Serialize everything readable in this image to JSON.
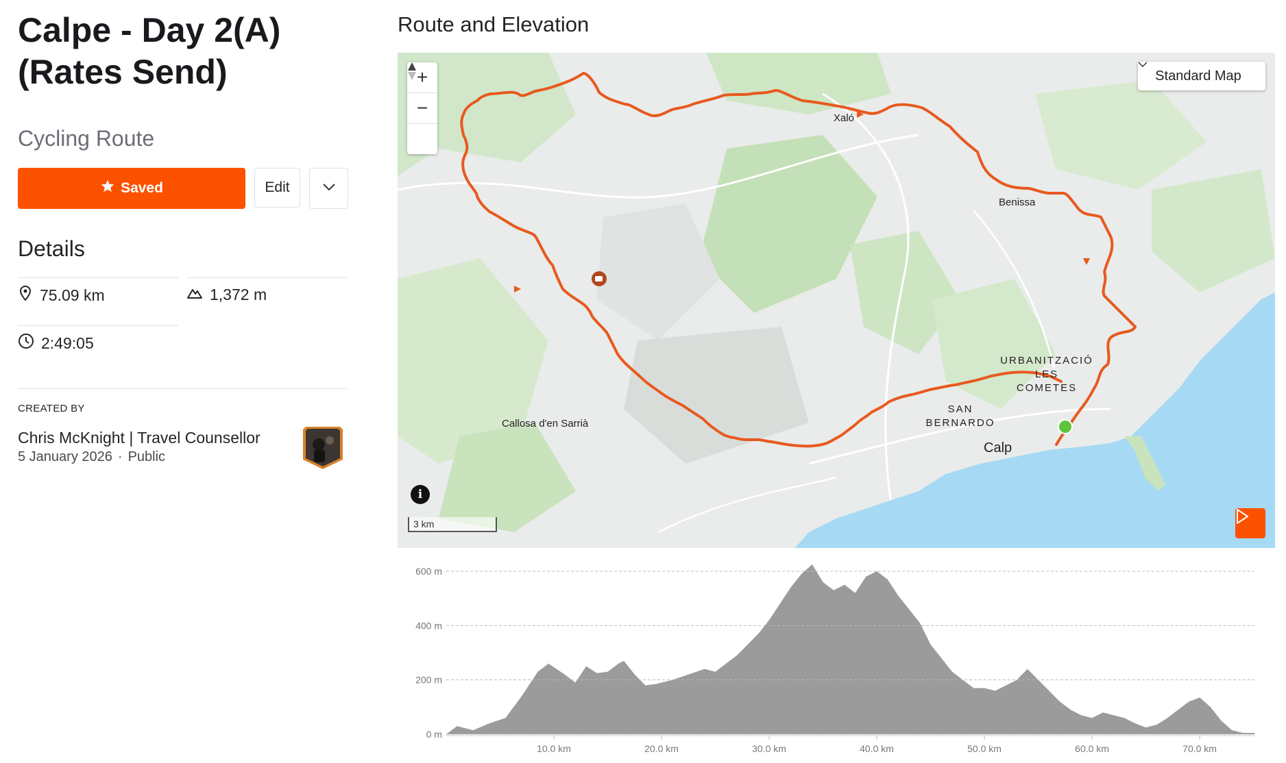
{
  "route": {
    "title": "Calpe - Day 2(A) (Rates Send)",
    "type": "Cycling Route",
    "saved_label": "Saved",
    "edit_label": "Edit",
    "details_heading": "Details",
    "distance": "75.09 km",
    "elevation_gain": "1,372 m",
    "moving_time": "2:49:05"
  },
  "creator": {
    "label": "CREATED BY",
    "name": "Chris McKnight | Travel Counsellor",
    "date": "5 January 2026",
    "separator": "·",
    "visibility": "Public"
  },
  "map": {
    "section_heading": "Route and Elevation",
    "map_type": "Standard Map",
    "scale_label": "3 km",
    "labels": {
      "xalo": "Xaló",
      "benissa": "Benissa",
      "callosa": "Callosa d'en Sarrià",
      "calp": "Calp",
      "urbanitzacio_1": "URBANITZACIÓ",
      "urbanitzacio_2": "LES",
      "urbanitzacio_3": "COMETES",
      "san_bernardo_1": "SAN",
      "san_bernardo_2": "BERNARDO"
    },
    "colors": {
      "route": "#e8591e",
      "water": "#a6d9f3",
      "land": "#e9ecea",
      "green": "#c8e3bf",
      "start": "#5fc33b"
    },
    "icons": [
      "zoom-in-icon",
      "zoom-out-icon",
      "compass-icon",
      "info-icon",
      "play-icon",
      "chevron-down-icon"
    ]
  },
  "chart_data": {
    "type": "area",
    "title": "",
    "xlabel": "",
    "ylabel": "",
    "x_ticks": [
      "10.0 km",
      "20.0 km",
      "30.0 km",
      "40.0 km",
      "50.0 km",
      "60.0 km",
      "70.0 km"
    ],
    "y_ticks": [
      "600 m",
      "400 m",
      "200 m",
      "0 m"
    ],
    "xlim": [
      0,
      75.09
    ],
    "ylim": [
      0,
      600
    ],
    "color": "#9b9b9b",
    "x": [
      0,
      1,
      2.5,
      4,
      5.5,
      7,
      8.5,
      9.5,
      11,
      12,
      13,
      14,
      15,
      16,
      16.5,
      17.5,
      18.5,
      19.5,
      21,
      22.5,
      24,
      25,
      26,
      27,
      28,
      29,
      30,
      31,
      32,
      33,
      34,
      35,
      36,
      37,
      38,
      39,
      40,
      41,
      42,
      43,
      44,
      45,
      46,
      47,
      48,
      49,
      50,
      51,
      52,
      53,
      54,
      55,
      56,
      57,
      58,
      59,
      60,
      61,
      62,
      63,
      64,
      65,
      66,
      67,
      68,
      69,
      70,
      71,
      72,
      73,
      74,
      75.09
    ],
    "y": [
      0,
      30,
      15,
      40,
      60,
      140,
      230,
      260,
      220,
      190,
      250,
      225,
      230,
      260,
      270,
      220,
      180,
      185,
      200,
      220,
      240,
      230,
      260,
      290,
      330,
      370,
      420,
      480,
      540,
      590,
      625,
      560,
      530,
      550,
      520,
      580,
      600,
      570,
      510,
      460,
      410,
      330,
      280,
      230,
      200,
      170,
      170,
      160,
      180,
      200,
      240,
      200,
      160,
      120,
      90,
      70,
      60,
      80,
      70,
      60,
      40,
      25,
      35,
      60,
      90,
      120,
      135,
      100,
      50,
      15,
      5,
      5
    ]
  }
}
